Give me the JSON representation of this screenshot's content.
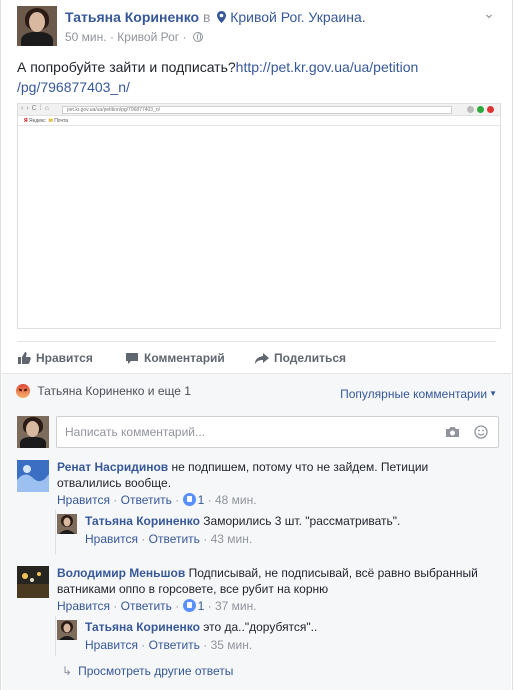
{
  "post": {
    "author": "Татьяна Кориненко",
    "in_word": "в",
    "place": "Кривой Рог. Украина.",
    "time": "50 мин.",
    "sep": "·",
    "location": "Кривой Рог",
    "text_before": "А попробуйте зайти и подписать?",
    "link": "http://pet.kr.gov.ua/ua/petition/pg/796877403_n/",
    "link_line1": "http://pet.kr.gov.ua/ua/petition",
    "link_line2": "/pg/796877403_n/",
    "shot_url": "pet.kr.gov.ua/ua/petition/pg/796877403_n/",
    "shot_bm_yandex": "Яндекс",
    "shot_bm_mail": "Почта"
  },
  "actions": {
    "like": "Нравится",
    "comment": "Комментарий",
    "share": "Поделиться"
  },
  "comments_header": {
    "reactions": "Татьяна Кориненко и еще 1",
    "sort": "Популярные комментарии"
  },
  "composer": {
    "placeholder": "Написать комментарий..."
  },
  "comments": [
    {
      "author": "Ренат Насридинов",
      "text": " не подпишем, потому что не зайдем. Петиции отвалились вообще.",
      "line1": " не подпишем, потому что не зайдем. Петиции",
      "line2": "отвалились вообще.",
      "like": "Нравится",
      "reply": "Ответить",
      "likes": "1",
      "time": "48 мин."
    },
    {
      "author": "Татьяна Кориненко",
      "text": " Заморились 3 шт. \"рассматривать\".",
      "like": "Нравится",
      "reply": "Ответить",
      "time": "43 мин."
    },
    {
      "author": "Володимир Меньшов",
      "line1": " Подписывай, не подписывай, всё равно выбранный",
      "line2": "ватниками оппо в горсовете, все рубит на корню",
      "like": "Нравится",
      "reply": "Ответить",
      "likes": "1",
      "time": "37 мин."
    },
    {
      "author": "Татьяна Кориненко",
      "text": " это да..\"дорубятся\"..",
      "like": "Нравится",
      "reply": "Ответить",
      "time": "35 мин."
    }
  ],
  "more_replies": "Просмотреть другие ответы",
  "dot": " · "
}
